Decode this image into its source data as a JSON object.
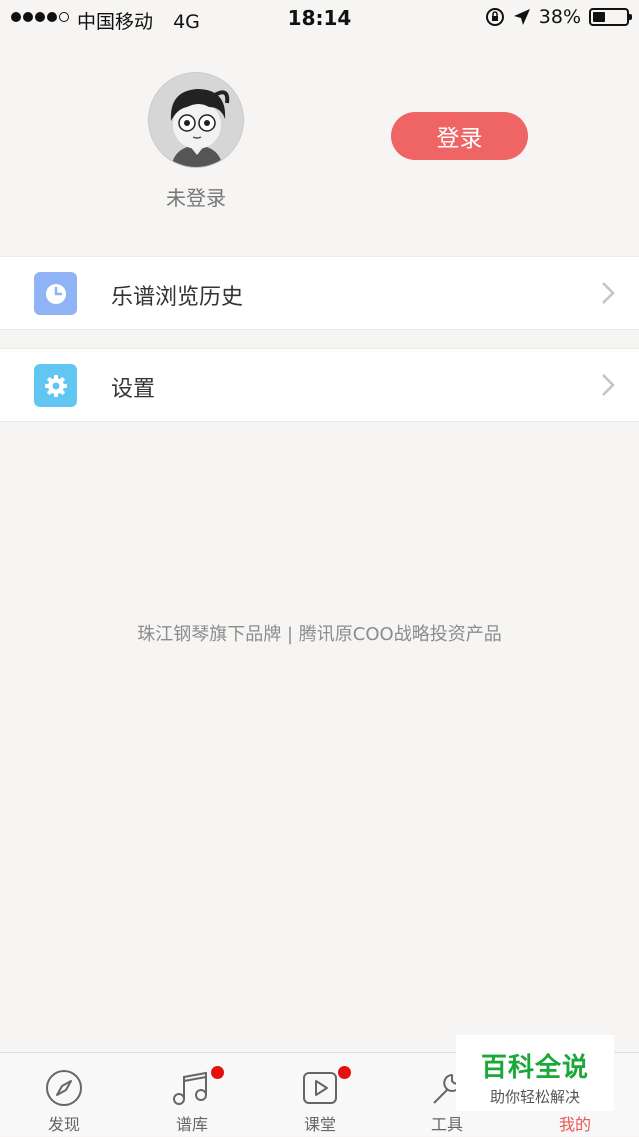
{
  "status_bar": {
    "carrier": "中国移动",
    "network": "4G",
    "time": "18:14",
    "battery": "38%",
    "battery_level": 0.38
  },
  "profile": {
    "username": "未登录",
    "login_label": "登录"
  },
  "menu": [
    {
      "label": "乐谱浏览历史",
      "icon": "clock-icon",
      "color": "#8fb3f5"
    },
    {
      "label": "设置",
      "icon": "gear-icon",
      "color": "#62c6f3"
    }
  ],
  "footer_note": "珠江钢琴旗下品牌 | 腾讯原COO战略投资产品",
  "tab_bar": {
    "tabs": [
      {
        "label": "发现",
        "icon": "compass-icon"
      },
      {
        "label": "谱库",
        "icon": "music-note-icon",
        "badge": true
      },
      {
        "label": "课堂",
        "icon": "play-icon",
        "badge": true
      },
      {
        "label": "工具",
        "icon": "wrench-icon"
      },
      {
        "label": "我的",
        "icon": "person-icon",
        "active": true
      }
    ]
  },
  "watermark": {
    "title": "百科全说",
    "subtitle": "助你轻松解决"
  },
  "colors": {
    "accent": "#ef6464",
    "active_tab": "#e85a55",
    "badge": "#e31010"
  }
}
